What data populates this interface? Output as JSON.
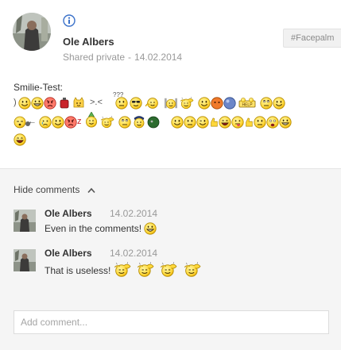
{
  "post": {
    "author": "Ole Albers",
    "visibility": "Shared private",
    "date_separator": "-",
    "date": "14.02.2014",
    "hashtag": "#Facepalm",
    "title": "Smilie-Test:",
    "text_emoticons": {
      "row1_prefix": ")",
      "row1_curious": ">.<",
      "row1_question": "???",
      "row3_arrow": "←",
      "row3_z": "z"
    }
  },
  "comments": {
    "toggle_label": "Hide comments",
    "items": [
      {
        "author": "Ole Albers",
        "date": "14.02.2014",
        "text": "Even in the comments!"
      },
      {
        "author": "Ole Albers",
        "date": "14.02.2014",
        "text": "That is useless!"
      }
    ]
  },
  "composer": {
    "placeholder": "Add comment..."
  },
  "colors": {
    "accent_blue": "#3a71c9",
    "smiley_yellow": "#ffd83b",
    "smiley_outline": "#b38b00"
  }
}
